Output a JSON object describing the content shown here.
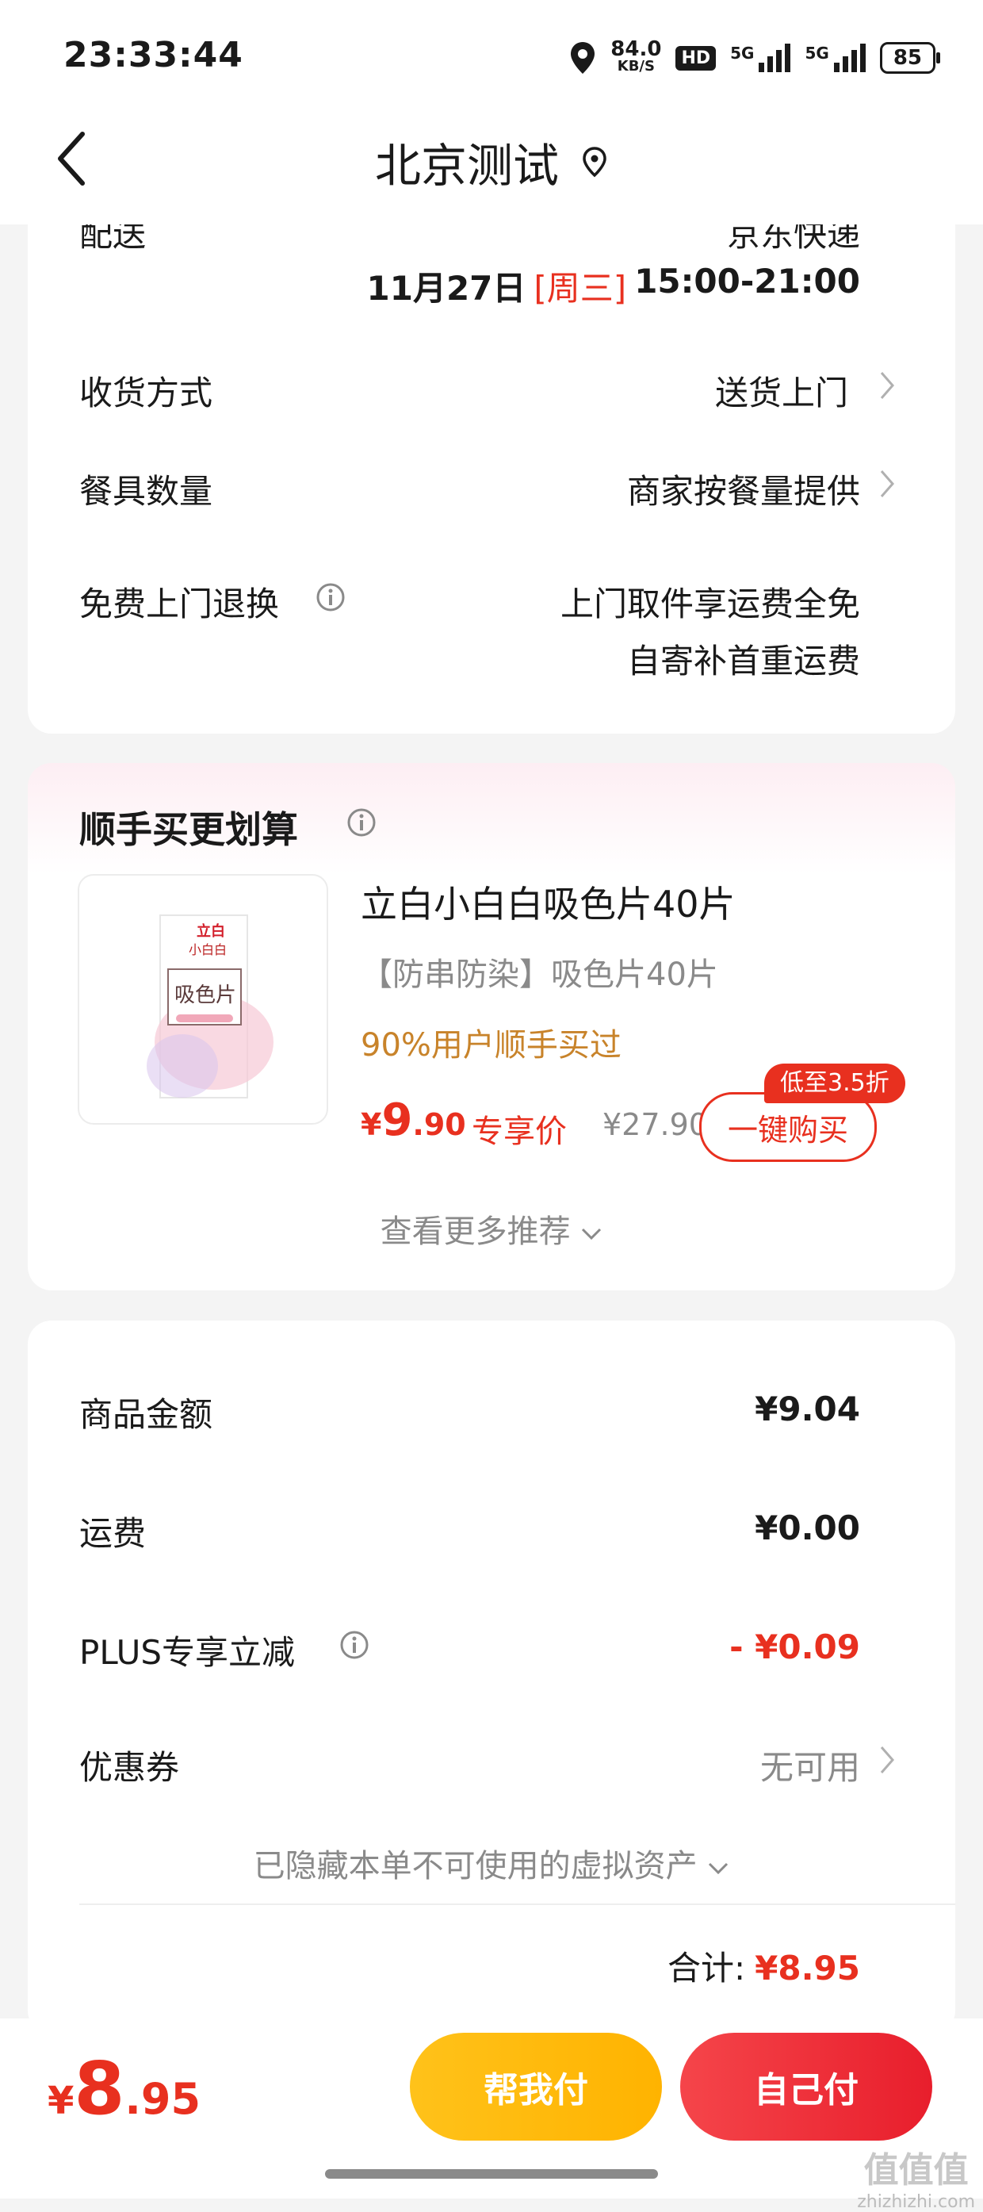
{
  "status_bar": {
    "time": "23:33:44",
    "net_speed_value": "84.0",
    "net_speed_unit": "KB/S",
    "hd": "HD",
    "sig1": "5G",
    "sig2": "5G",
    "battery": "85"
  },
  "header": {
    "title": "北京测试"
  },
  "delivery": {
    "cut_label": "配送",
    "cut_value": "京东快递",
    "date": "11月27日",
    "weekday": "[周三]",
    "time_range": "15:00-21:00",
    "rows": [
      {
        "label": "收货方式",
        "value": "送货上门"
      },
      {
        "label": "餐具数量",
        "value": "商家按餐量提供"
      },
      {
        "label": "免费上门退换",
        "value_line1": "上门取件享运费全免",
        "value_line2": "自寄补首重运费"
      }
    ]
  },
  "recommend": {
    "title": "顺手买更划算",
    "product_name": "立白小白白吸色片40片",
    "subtitle": "【防串防染】吸色片40片",
    "social_proof": "90%用户顺手买过",
    "price_symbol": "¥",
    "price_int": "9",
    "price_dec": ".90",
    "exclusive_label": "专享价",
    "original_price": "¥27.90",
    "discount_tag": "低至3.5折",
    "buy_label": "一键购买",
    "more_label": "查看更多推荐",
    "package_brand": "立白",
    "package_sub": "小白白",
    "package_text": "吸色片"
  },
  "summary": {
    "rows": [
      {
        "label": "商品金额",
        "value": "¥9.04"
      },
      {
        "label": "运费",
        "value": "¥0.00"
      },
      {
        "label": "PLUS专享立减",
        "value": "- ¥0.09"
      },
      {
        "label": "优惠券",
        "value": "无可用"
      }
    ],
    "hidden_note": "已隐藏本单不可使用的虚拟资产",
    "total_label": "合计:",
    "total_value": "¥8.95"
  },
  "bottom_bar": {
    "currency": "¥",
    "amount_int": "8",
    "amount_dec": ".95",
    "help_pay": "帮我付",
    "self_pay": "自己付"
  },
  "watermark": "值值值",
  "watermark_url": "zhizhizhi.com",
  "colors": {
    "accent_red": "#e8301f",
    "gold": "#c8832a",
    "help_pay_yellow": "#ffb300"
  }
}
